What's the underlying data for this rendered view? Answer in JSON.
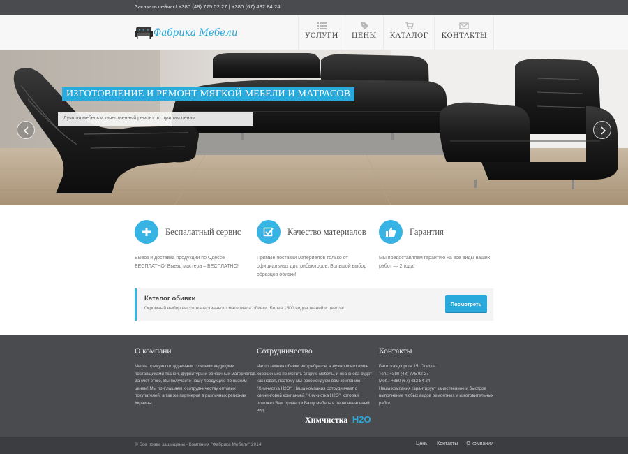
{
  "topbar": {
    "phones": "Заказать сейчас! +380 (48) 775 02 27  |  +380 (67) 482 84 24"
  },
  "header": {
    "logo_text": "Фабрика Мебели",
    "nav": [
      {
        "label": "УСЛУГИ",
        "icon": "list-icon"
      },
      {
        "label": "ЦЕНЫ",
        "icon": "tags-icon"
      },
      {
        "label": "КАТАЛОГ",
        "icon": "cart-icon"
      },
      {
        "label": "КОНТАКТЫ",
        "icon": "envelope-icon"
      }
    ]
  },
  "hero": {
    "title": "ИЗГОТОВЛЕНИЕ И РЕМОНТ МЯГКОЙ МЕБЕЛИ И МАТРАСОВ",
    "subtitle": "Лучшая мебель и качественный ремонт по лучшим ценам"
  },
  "features": [
    {
      "title": "Беспалатный сервис",
      "icon": "plus-icon",
      "text": "Вывоз и доставка продукции по Одессе – БЕСПЛАТНО! Выезд мастера – БЕСПЛАТНО!"
    },
    {
      "title": "Качество материалов",
      "icon": "check-icon",
      "text": "Прямые поставки материалов только от официальных дистрибьюторов. Большой выбор образцов обивки!"
    },
    {
      "title": "Гарантия",
      "icon": "thumbs-up-icon",
      "text": "Мы предоставляем гарантию на все виды наших работ — 2 года!"
    }
  ],
  "catalog": {
    "title": "Каталог обивки",
    "text": "Огромный выбор высококачественного материала обивки. Более 1500 видов тканей и цветов!",
    "button": "Посмотреть"
  },
  "footer": {
    "about": {
      "title": "О компани",
      "lines": [
        "Мы на прямую сотрудничаем со всеми ведущими",
        "поставщиками тканей, фурнитуры и обивочных материалов.",
        "За счет этого, Вы получаете нашу продукцию по низким",
        "ценам! Мы приглашаем к сотрудничеству оптовых",
        "покупателей, а так же партнеров в различных регионах",
        "Украины."
      ]
    },
    "partners": {
      "title": "Сотрудничество",
      "lines": [
        "Часто замена обивки не требуется, а нужно всего лишь",
        "хорошенько почистить старую мебель, и она снова будет",
        "как новая, поэтому мы рекомендуем вам компанию",
        "\"Химчистка H2O\". Наша компания сотрудничает с",
        "клининговой компанией \"Химчистка H2O\", которая",
        "поможет Вам привести Вашу мебель в первоначальный",
        "вид."
      ],
      "logo_text": "Химчистка",
      "logo_mark": "H2O"
    },
    "contacts": {
      "title": "Контакты",
      "lines": [
        "Балтская дорога 15, Одесса.",
        "Тел.: +380 (48) 775 02 27",
        "Моб.: +380 (67) 482 84 24",
        "Наша компания гарантирует качественное и быстрое",
        "выполнение любых видов ремонтных и изготовительных",
        "работ."
      ]
    }
  },
  "bottombar": {
    "copyright": "© Все права защищены - Компания \"Фабрика Мебели\" 2014",
    "links": [
      "Цены",
      "Контакты",
      "О компании"
    ]
  },
  "colors": {
    "accent": "#2aa9dc",
    "dark": "#4a4b4f",
    "darker": "#3c3d41"
  }
}
